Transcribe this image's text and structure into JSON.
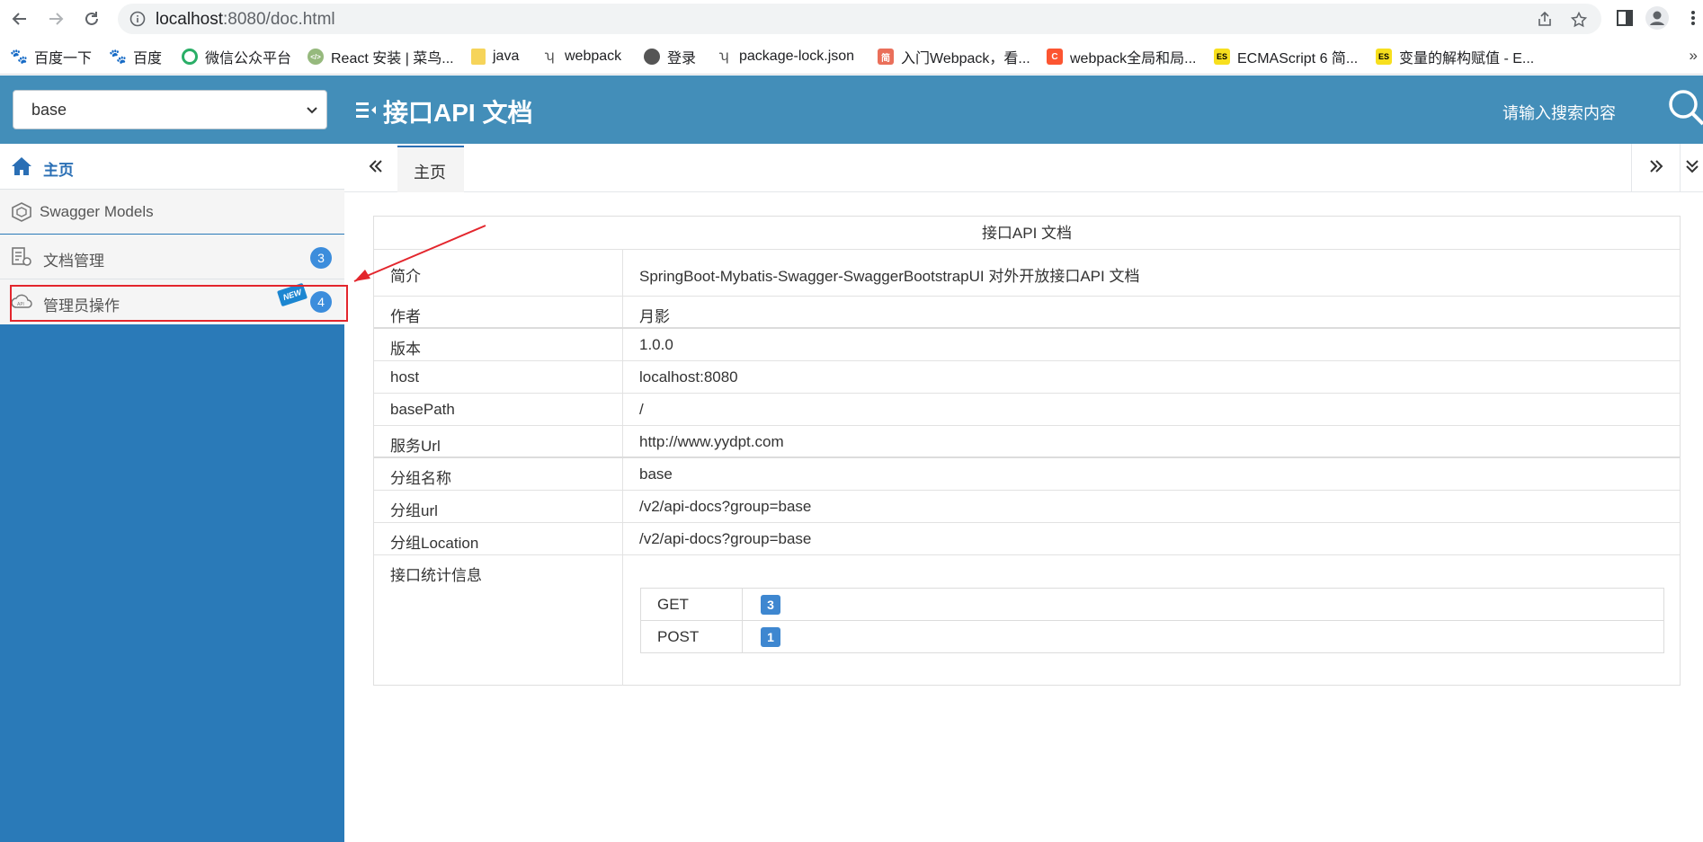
{
  "browser": {
    "url_host": "localhost",
    "url_path": ":8080/doc.html",
    "bookmarks": [
      {
        "label": "百度一下",
        "icon": "baidu-paw-icon",
        "color": "#2932e1"
      },
      {
        "label": "百度",
        "icon": "baidu-paw-icon",
        "color": "#2932e1"
      },
      {
        "label": "微信公众平台",
        "icon": "wechat-icon",
        "color": "#2aae67"
      },
      {
        "label": "React 安装 | 菜鸟...",
        "icon": "runoob-icon",
        "color": "#96b97d"
      },
      {
        "label": "java",
        "icon": "folder-icon",
        "color": "#f6d45a"
      },
      {
        "label": "webpack",
        "icon": "webpack-icon",
        "color": "#555555"
      },
      {
        "label": "登录",
        "icon": "globe-icon",
        "color": "#555555"
      },
      {
        "label": "package-lock.json",
        "icon": "webpack-icon",
        "color": "#555555"
      },
      {
        "label": "入门Webpack，看...",
        "icon": "jianshu-icon",
        "color": "#ea6f5a",
        "glyph": "简"
      },
      {
        "label": "webpack全局和局...",
        "icon": "csdn-icon",
        "color": "#fc5531",
        "glyph": "C"
      },
      {
        "label": "ECMAScript 6 简...",
        "icon": "es-icon",
        "color": "#f7df1e",
        "glyph": "ES"
      },
      {
        "label": "变量的解构赋值 - E...",
        "icon": "es-icon",
        "color": "#f7df1e",
        "glyph": "ES"
      }
    ],
    "more": "»"
  },
  "header": {
    "group_select_value": "base",
    "title": "接口API 文档",
    "search_placeholder": "请输入搜索内容"
  },
  "sidebar": {
    "items": [
      {
        "label": "主页",
        "icon": "home-icon"
      },
      {
        "label": "Swagger Models",
        "icon": "models-icon"
      },
      {
        "label": "文档管理",
        "icon": "doc-settings-icon",
        "badge": "3"
      },
      {
        "label": "管理员操作",
        "icon": "api-cloud-icon",
        "badge": "4",
        "tag": "NEW"
      }
    ]
  },
  "tabs": {
    "items": [
      {
        "label": "主页"
      }
    ]
  },
  "doc": {
    "title": "接口API 文档",
    "rows": [
      {
        "key": "简介",
        "value": "SpringBoot-Mybatis-Swagger-SwaggerBootstrapUI 对外开放接口API 文档"
      },
      {
        "key": "作者",
        "value": "月影"
      },
      {
        "key": "版本",
        "value": "1.0.0"
      },
      {
        "key": "host",
        "value": "localhost:8080"
      },
      {
        "key": "basePath",
        "value": "/"
      },
      {
        "key": "服务Url",
        "value": "http://www.yydpt.com"
      },
      {
        "key": "分组名称",
        "value": "base"
      },
      {
        "key": "分组url",
        "value": "/v2/api-docs?group=base"
      },
      {
        "key": "分组Location",
        "value": "/v2/api-docs?group=base"
      },
      {
        "key": "接口统计信息",
        "value": ""
      }
    ],
    "stats": [
      {
        "method": "GET",
        "count": "3"
      },
      {
        "method": "POST",
        "count": "1"
      }
    ]
  },
  "colors": {
    "header_bg": "#438eb9",
    "sidebar_bg": "#2a7ab8",
    "badge": "#3c8ddc",
    "highlight": "#e3262d"
  }
}
